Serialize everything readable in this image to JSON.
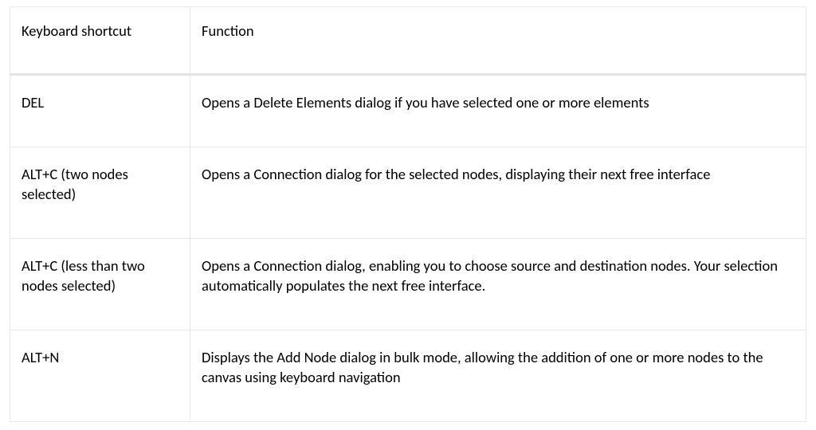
{
  "table": {
    "headers": {
      "shortcut": "Keyboard shortcut",
      "function": "Function"
    },
    "rows": [
      {
        "shortcut": "DEL",
        "function": "Opens a Delete Elements dialog if you have selected one or more elements"
      },
      {
        "shortcut": "ALT+C (two nodes selected)",
        "function": "Opens a Connection dialog for the selected nodes, displaying their next free interface"
      },
      {
        "shortcut": "ALT+C (less than two nodes selected)",
        "function": "Opens a Connection dialog, enabling you to choose source and destination nodes. Your selection automatically populates the next free interface."
      },
      {
        "shortcut": "ALT+N",
        "function": "Displays the Add Node dialog in bulk mode, allowing the addition of one or more nodes to the canvas using keyboard navigation"
      }
    ]
  }
}
